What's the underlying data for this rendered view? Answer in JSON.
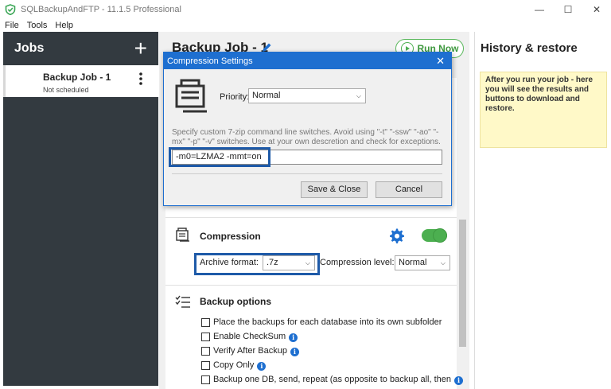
{
  "window": {
    "title": "SQLBackupAndFTP - 11.1.5 Professional",
    "minimize": "—",
    "maximize": "☐",
    "close": "✕"
  },
  "menu": [
    "File",
    "Tools",
    "Help"
  ],
  "jobs": {
    "header": "Jobs",
    "add_symbol": "+",
    "items": [
      {
        "name": "Backup Job - 1",
        "status": "Not scheduled"
      }
    ]
  },
  "job_panel": {
    "title": "Backup Job - 1",
    "run_now": "Run Now",
    "compression": {
      "title": "Compression",
      "enabled": true,
      "archive_format_label": "Archive format:",
      "archive_format_value": ".7z",
      "level_label": "Compression level:",
      "level_value": "Normal"
    },
    "backup_options": {
      "title": "Backup options",
      "options": [
        {
          "label": "Place the backups for each database into its own subfolder",
          "checked": false,
          "info": false
        },
        {
          "label": "Enable CheckSum",
          "checked": false,
          "info": true
        },
        {
          "label": "Verify After Backup",
          "checked": false,
          "info": true
        },
        {
          "label": "Copy Only",
          "checked": false,
          "info": true
        },
        {
          "label": "Backup one DB, send, repeat (as opposite to backup all, then",
          "checked": false,
          "info": true
        }
      ]
    }
  },
  "history": {
    "title": "History & restore",
    "note": "After you run your job - here you will see the results and buttons to download and restore."
  },
  "dialog": {
    "title": "Compression Settings",
    "close": "✕",
    "priority_label": "Priority:",
    "priority_value": "Normal",
    "description": "Specify custom 7-zip command line switches. Avoid using \"-t\" \"-ssw\" \"-ao\" \"-mx\" \"-p\" \"-v\" switches. Use at your own descretion and check for exceptions.",
    "switches_value": "-m0=LZMA2 -mmt=on",
    "save_label": "Save & Close",
    "cancel_label": "Cancel"
  },
  "colors": {
    "accent_blue": "#1e6fd0",
    "highlight_blue": "#1e5aa8",
    "green": "#4caf50",
    "sidebar_dark": "#333a40",
    "note_yellow": "#fff9c8"
  }
}
